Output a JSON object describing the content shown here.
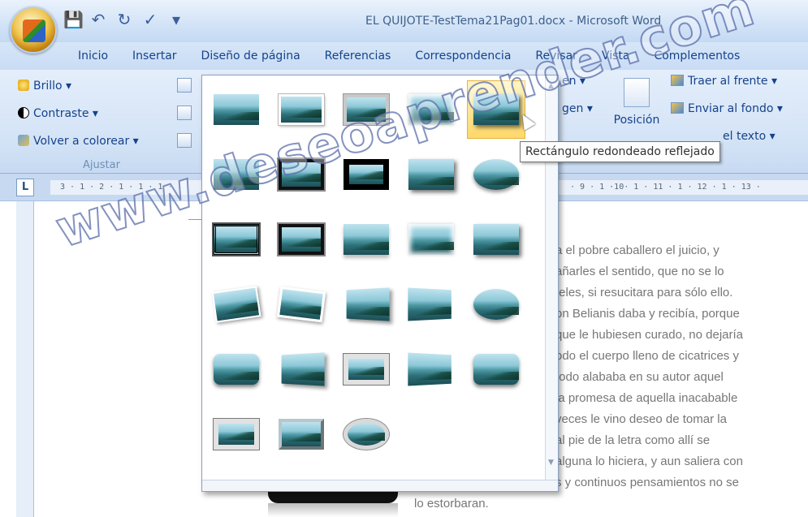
{
  "window": {
    "title": "EL QUIJOTE-TestTema21Pag01.docx - Microsoft Word"
  },
  "ribbon_tabs": [
    "Inicio",
    "Insertar",
    "Diseño de página",
    "Referencias",
    "Correspondencia",
    "Revisar",
    "Vista",
    "Complementos"
  ],
  "adjust_group": {
    "label": "Ajustar",
    "items": [
      "Brillo ▾",
      "Contraste ▾",
      "Volver a colorear ▾"
    ]
  },
  "arrange_group": {
    "cut_items": [
      "en ▾",
      "gen ▾"
    ],
    "position_label": "Posición",
    "items": [
      "Traer al frente ▾",
      "Enviar al fondo ▾",
      "el texto ▾"
    ]
  },
  "gallery": {
    "hovered_style": "Rectángulo redondeado reflejado",
    "styles": [
      "plain",
      "white",
      "gray",
      "soft",
      "shadow",
      "plain",
      "black",
      "thickblack",
      "shadow",
      "oval",
      "dbl",
      "black",
      "refl",
      "soft",
      "shadow",
      "tilt",
      "tilt2",
      "persp",
      "persp2",
      "oval",
      "round",
      "persp",
      "frame",
      "persp2",
      "round",
      "frame",
      "bevel",
      "ring"
    ]
  },
  "tooltip": {
    "text": "Rectángulo redondeado reflejado"
  },
  "ruler": {
    "corner": "L",
    "left_marks": "3 · 1 · 2 · 1 · 1 · 1 ·",
    "right_marks": "· 9 · 1 ·10· 1 · 11 · 1 · 12 · 1 · 13 ·"
  },
  "document": {
    "lines": [
      "a el pobre caballero el juicio, y",
      "añarles el sentido, que no se lo",
      "teles, si resucitara para sólo ello.",
      "on Belianis daba y recibía, porque",
      "que le hubiesen curado, no dejaría",
      "odo el cuerpo lleno de cicatrices y",
      "todo alababa en su autor aquel",
      "la promesa de aquella inacabable",
      "veces le vino deseo de tomar la",
      "al pie de la letra como allí se",
      "alguna lo hiciera, y aun saliera con",
      "s y continuos pensamientos no se"
    ],
    "last_line": "lo estorbaran."
  },
  "watermark": "www.deseoaprender.com"
}
